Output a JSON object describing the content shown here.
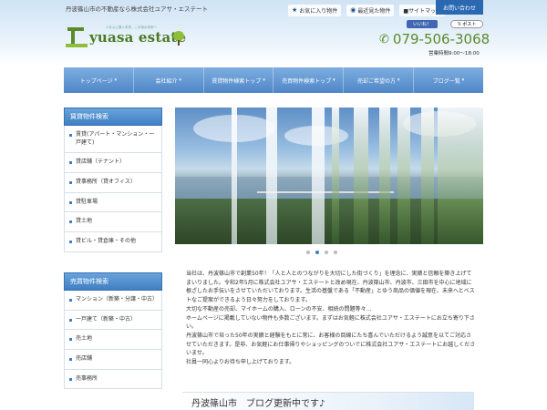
{
  "header": {
    "tagline": "丹波篠山市の不動産なら株式会社ユアサ・エステート",
    "logo_text": "yuasa estate",
    "logo_sub": "人を心に繋ぐ未来、この街の未来へ",
    "top_links": [
      {
        "icon": "star-icon",
        "label": "お気に入り物件"
      },
      {
        "icon": "eye-icon",
        "label": "最近見た物件"
      },
      {
        "icon": "sitemap-icon",
        "label": "■サイトマップ"
      }
    ],
    "contact_label": "お問い合わせ",
    "fb_label": "いいね！",
    "x_label": "𝕏 ポスト",
    "phone": "079-506-3068",
    "hours": "営業時間9:00～18:00"
  },
  "nav": {
    "items": [
      "トップページ",
      "会社紹介",
      "賃貸物件検索トップ",
      "売買物件検索トップ",
      "売却ご希望の方",
      "ブログ一覧"
    ]
  },
  "sidebar": {
    "rent_heading": "賃貸物件検索",
    "rent_items": [
      "賃貸(アパート・マンション・一戸建て)",
      "貸店舗（テナント）",
      "貸事務所（貸オフィス）",
      "貸駐車場",
      "貸土地",
      "貸ビル・貸倉庫・その他"
    ],
    "sale_heading": "売買物件検索",
    "sale_items": [
      "マンション（新築・分譲・中古）",
      "一戸建て（新築・中古）",
      "売土地",
      "売店舗",
      "売事務所"
    ]
  },
  "slider": {
    "dot_count": 4,
    "active_index": 1
  },
  "intro": {
    "paragraphs": [
      "当社は、丹波篠山市で創業50年！「人と人とのつながりを大切にした街づくり」を理念に、実績と信頼を築き上げてまいりました。令和2年5月に株式会社ユアサ・エステートと改め現在、丹波篠山市、丹波市、三田市を中心に地域に根ざしたお手伝いをさせていただいております。生活の基盤である「不動産」とゆう商品の価値を現在、未来へとベストなご提案ができるよう日々努力をしております。",
      "大切な不動産の売却、マイホームの購入、ローンの不安、相続の問題等々…",
      "ホームページに掲載していない物件も多数ございます。まずはお気軽に株式会社ユアサ・エステートにお立ち寄り下さい。",
      "丹波篠山市で培った50年の実績と経験をもとに常に、お客様の目線にたち喜んでいただけるよう誠意を以てご対応させていただきます。是非、お気軽にお仕事帰りやショッピングのついでに株式会社ユアサ・エステートにお越しくださいませ。",
      "社員一同心よりお待ち申し上げております。"
    ]
  },
  "blog": {
    "banner": "丹波篠山市　ブログ更新中です♪"
  },
  "colors": {
    "primary_blue": "#3f7fc2",
    "logo_green": "#5c8a2a",
    "contact_blue": "#2a68b2"
  }
}
